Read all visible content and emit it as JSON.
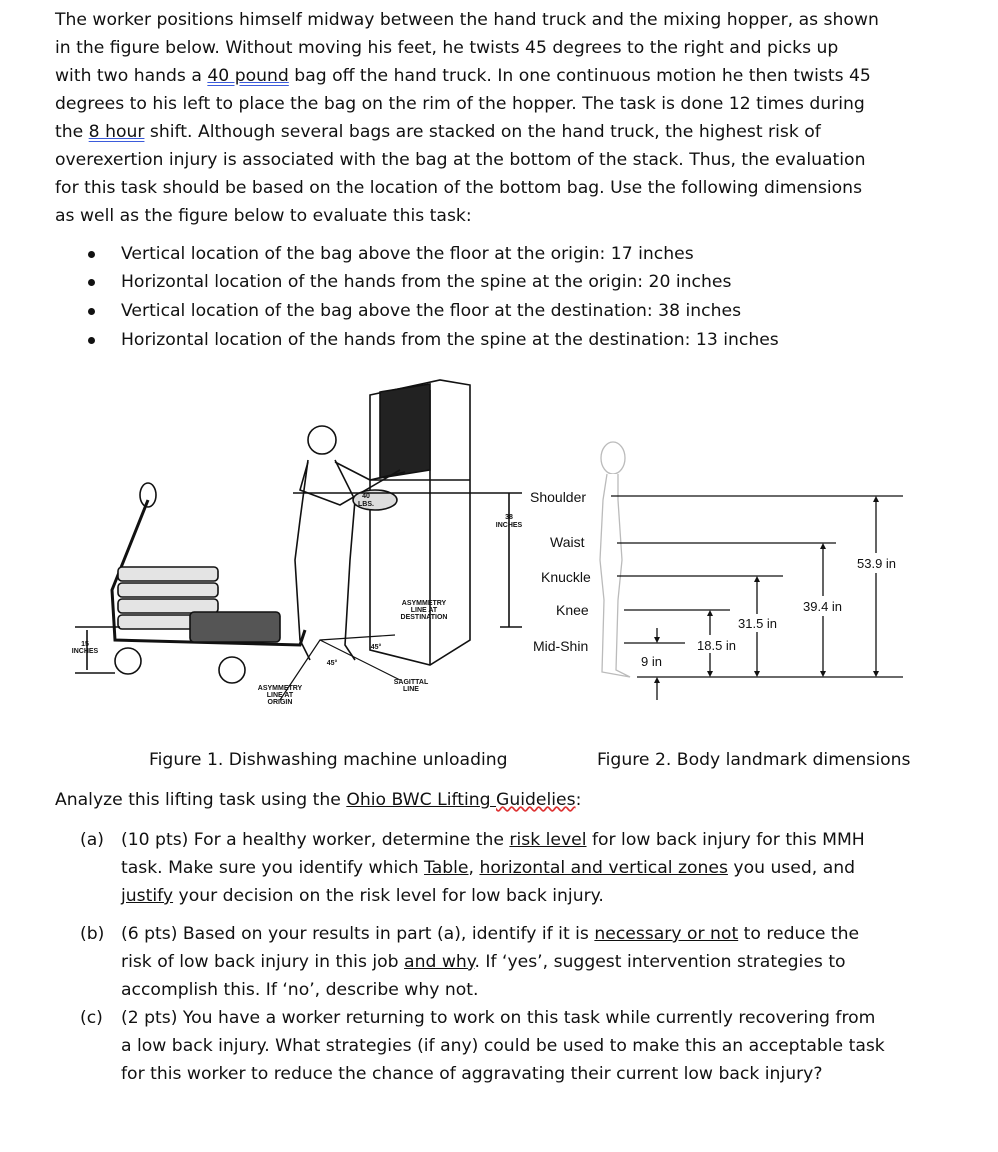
{
  "intro": {
    "l1": "The worker positions himself midway between the hand truck and the mixing hopper, as shown",
    "l2": "in the figure below.  Without moving his feet, he twists 45 degrees to the right and picks up",
    "l3a": "with two hands a ",
    "l3b": "40 pound",
    "l3c": " bag off the hand truck.  In one continuous motion he then twists 45",
    "l4": "degrees to his left to place the bag on the rim of the hopper.  The task is done 12 times during",
    "l5a": "the ",
    "l5b": "8 hour",
    "l5c": " shift.  Although several bags are stacked on the hand truck, the highest risk of",
    "l6": "overexertion injury is associated with the bag at the bottom of the stack.  Thus, the evaluation",
    "l7": "for this task should be based on the location of the bottom bag.  Use the following dimensions",
    "l8": "as well as the figure below to evaluate this task:"
  },
  "bullets": [
    "Vertical location of the bag above the floor at the origin: 17 inches",
    "Horizontal location of the hands from the spine at the origin: 20 inches",
    "Vertical location of the bag above the floor at the destination: 38 inches",
    "Horizontal location of the hands from the spine at the destination: 13 inches"
  ],
  "figure1": {
    "caption": "Figure 1. Dishwashing machine unloading",
    "bag_label": [
      "40",
      "LBS."
    ],
    "v_label": [
      "V",
      "38",
      "INCHES"
    ],
    "cart_height": [
      "15",
      "INCHES"
    ],
    "asym_dest": [
      "ASYMMETRY",
      "LINE AT",
      "DESTINATION"
    ],
    "asym_origin": [
      "ASYMMETRY",
      "LINE AT",
      "ORIGIN"
    ],
    "sagittal": [
      "SAGITTAL",
      "LINE"
    ],
    "angle": "45°"
  },
  "figure2": {
    "caption": "Figure 2. Body landmark dimensions",
    "landmarks": [
      "Shoulder",
      "Waist",
      "Knuckle",
      "Knee",
      "Mid-Shin"
    ],
    "dims": [
      "53.9 in",
      "39.4 in",
      "31.5 in",
      "18.5 in",
      "9 in"
    ]
  },
  "analyze": {
    "a": "Analyze this lifting task using the ",
    "link": "Ohio BWC Lifting ",
    "typo": "Guidelies",
    "end": ":"
  },
  "parts": {
    "a_tag": "(a)",
    "a1a": "(10 pts) For a healthy worker, determine the ",
    "a1b": "risk level",
    "a1c": " for low back injury for this MMH",
    "a2a": "task.  Make sure you identify which ",
    "a2b": "Table",
    "a2c": ", ",
    "a2d": "horizontal and vertical zones",
    "a2e": " you used, and",
    "a3a": "justify",
    "a3b": " your decision on the risk level for low back injury.",
    "b_tag": "(b)",
    "b1a": "(6 pts) Based on your results in part (a), identify if it is ",
    "b1b": "necessary or not",
    "b1c": " to reduce the",
    "b2a": "risk of low back injury in this job ",
    "b2b": "and why",
    "b2c": ".  If ‘yes’, suggest intervention strategies to",
    "b3": "accomplish this.  If ‘no’, describe why not.",
    "c_tag": "(c)",
    "c1": "(2 pts) You have a worker returning to work on this task while currently recovering from",
    "c2": "a low back injury.  What strategies (if any) could be used to make this an acceptable task",
    "c3": "for this worker to reduce the chance of aggravating their current low back injury?"
  }
}
